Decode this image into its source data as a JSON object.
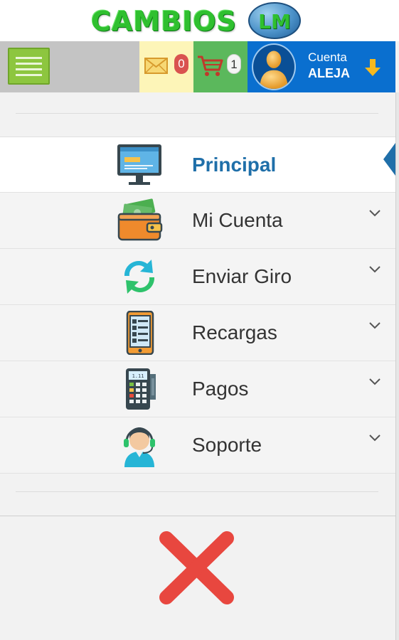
{
  "logo": {
    "text": "CAMBIOS",
    "badge": "LM"
  },
  "topbar": {
    "menu_icon": "hamburger-menu-icon",
    "mail": {
      "icon": "envelope-icon",
      "count": "0",
      "badge_color": "#d9534f"
    },
    "cart": {
      "icon": "shopping-cart-icon",
      "count": "1"
    },
    "account": {
      "icon": "user-avatar-icon",
      "label": "Cuenta",
      "name": "ALEJA",
      "arrow_icon": "down-arrow-icon"
    }
  },
  "menu": {
    "items": [
      {
        "label": "Principal",
        "icon": "monitor-icon",
        "active": true
      },
      {
        "label": "Mi Cuenta",
        "icon": "wallet-icon",
        "active": false
      },
      {
        "label": "Enviar Giro",
        "icon": "exchange-arrows-icon",
        "active": false
      },
      {
        "label": "Recargas",
        "icon": "mobile-phone-icon",
        "active": false
      },
      {
        "label": "Pagos",
        "icon": "payment-terminal-icon",
        "active": false
      },
      {
        "label": "Soporte",
        "icon": "support-agent-icon",
        "active": false
      }
    ]
  },
  "close": {
    "icon": "close-x-icon"
  },
  "colors": {
    "accent": "#0a6fcf",
    "active_text": "#1f6fa9",
    "menu_button": "#8dc63f",
    "close": "#e8473f"
  }
}
